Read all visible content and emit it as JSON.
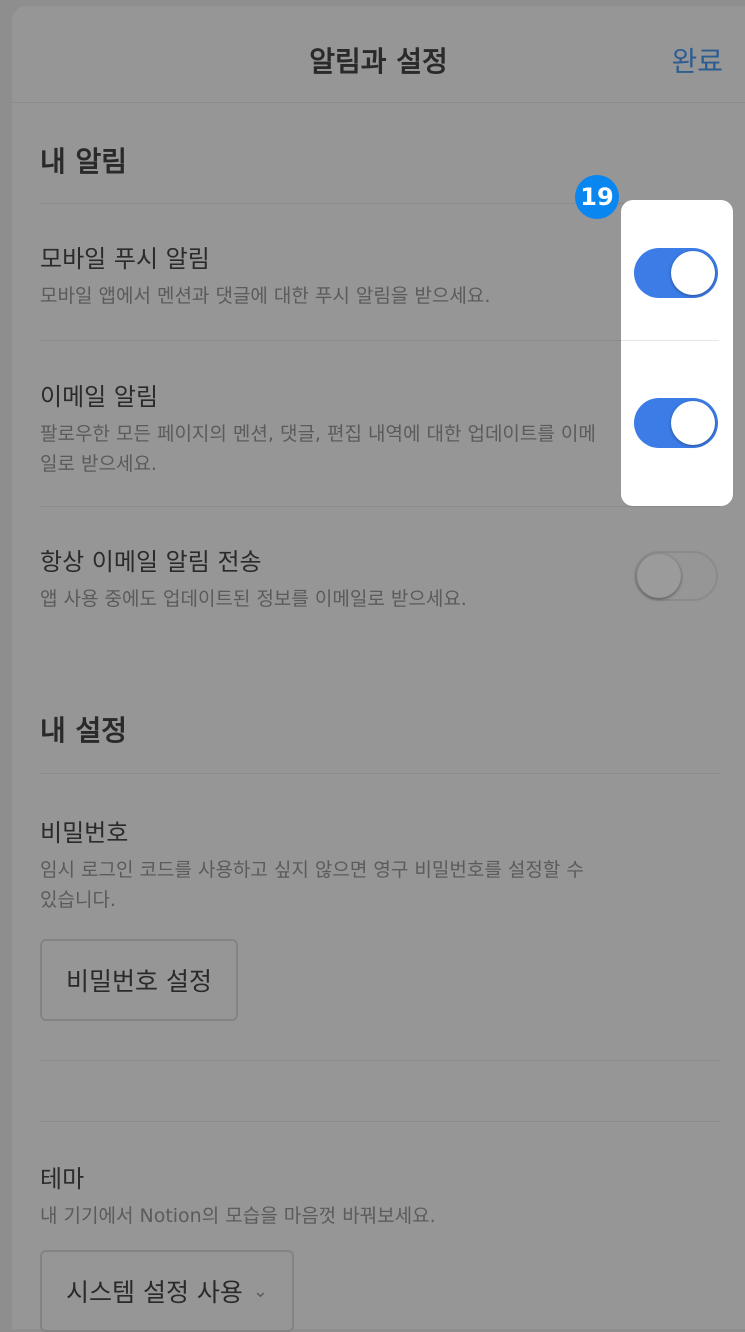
{
  "header": {
    "title": "알림과 설정",
    "done_label": "완료"
  },
  "notifications": {
    "section_title": "내 알림",
    "items": [
      {
        "title": "모바일 푸시 알림",
        "desc": "모바일 앱에서 멘션과 댓글에 대한 푸시 알림을 받으세요.",
        "enabled": true
      },
      {
        "title": "이메일 알림",
        "desc": "팔로우한 모든 페이지의 멘션, 댓글, 편집 내역에 대한 업데이트를 이메일로 받으세요.",
        "enabled": true
      },
      {
        "title": "항상 이메일 알림 전송",
        "desc": "앱 사용 중에도 업데이트된 정보를 이메일로 받으세요.",
        "enabled": false
      }
    ]
  },
  "settings": {
    "section_title": "내 설정",
    "password": {
      "title": "비밀번호",
      "desc": "임시 로그인 코드를 사용하고 싶지 않으면 영구 비밀번호를 설정할 수 있습니다.",
      "button_label": "비밀번호 설정"
    },
    "theme": {
      "title": "테마",
      "desc": "내 기기에서 Notion의 모습을 마음껏 바꿔보세요.",
      "select_value": "시스템 설정 사용"
    }
  },
  "annotation": {
    "badge_number": "19"
  },
  "colors": {
    "toggle_on": "#3b7ce6",
    "link": "#2c5d92",
    "badge": "#0a86f0"
  }
}
